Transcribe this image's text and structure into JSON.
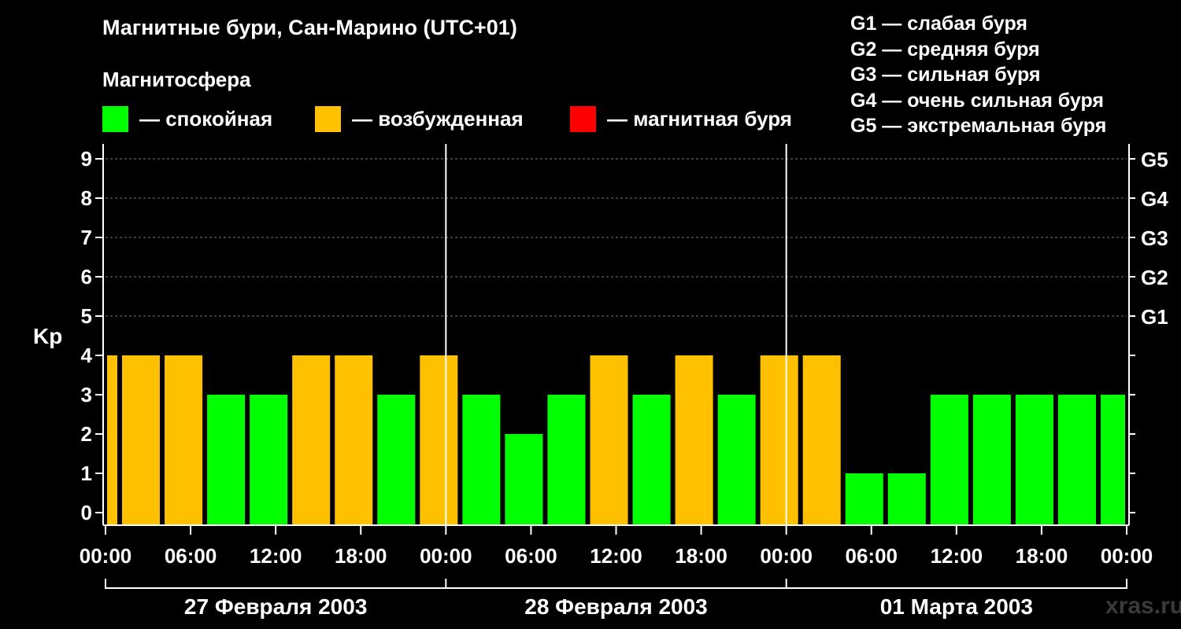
{
  "title": "Магнитные бури, Сан-Марино (UTC+01)",
  "subtitle": "Магнитосфера",
  "legend": [
    {
      "label": "— спокойная",
      "color": "#00ff00"
    },
    {
      "label": "— возбужденная",
      "color": "#ffc000"
    },
    {
      "label": "— магнитная буря",
      "color": "#ff0000"
    }
  ],
  "g_levels": [
    "G1 — слабая буря",
    "G2 — средняя буря",
    "G3 — сильная буря",
    "G4 — очень сильная буря",
    "G5 — экстремальная буря"
  ],
  "watermark": "xras.ru",
  "chart_data": {
    "type": "bar",
    "ylabel": "Kp",
    "ylim": [
      0,
      9
    ],
    "y_ticks": [
      "0",
      "1",
      "2",
      "3",
      "4",
      "5",
      "6",
      "7",
      "8",
      "9"
    ],
    "right_axis_labels": [
      {
        "kp": 5,
        "label": "G1"
      },
      {
        "kp": 6,
        "label": "G2"
      },
      {
        "kp": 7,
        "label": "G3"
      },
      {
        "kp": 8,
        "label": "G4"
      },
      {
        "kp": 9,
        "label": "G5"
      }
    ],
    "x_tick_labels": [
      "00:00",
      "06:00",
      "12:00",
      "18:00",
      "00:00",
      "06:00",
      "12:00",
      "18:00",
      "00:00",
      "06:00",
      "12:00",
      "18:00",
      "00:00"
    ],
    "x_hours_range": [
      0,
      72
    ],
    "day_labels": [
      "27 Февраля 2003",
      "28 Февраля 2003",
      "01 Марта 2003"
    ],
    "grid": "horizontal dashed",
    "colors": {
      "quiet": "#00ff00",
      "active": "#ffc000",
      "storm": "#ff0000"
    },
    "bars": [
      {
        "start_hour": 0,
        "end_hour": 1,
        "kp": 4
      },
      {
        "start_hour": 1,
        "end_hour": 4,
        "kp": 4
      },
      {
        "start_hour": 4,
        "end_hour": 7,
        "kp": 4
      },
      {
        "start_hour": 7,
        "end_hour": 10,
        "kp": 3
      },
      {
        "start_hour": 10,
        "end_hour": 13,
        "kp": 3
      },
      {
        "start_hour": 13,
        "end_hour": 16,
        "kp": 4
      },
      {
        "start_hour": 16,
        "end_hour": 19,
        "kp": 4
      },
      {
        "start_hour": 19,
        "end_hour": 22,
        "kp": 3
      },
      {
        "start_hour": 22,
        "end_hour": 25,
        "kp": 4
      },
      {
        "start_hour": 25,
        "end_hour": 28,
        "kp": 3
      },
      {
        "start_hour": 28,
        "end_hour": 31,
        "kp": 2
      },
      {
        "start_hour": 31,
        "end_hour": 34,
        "kp": 3
      },
      {
        "start_hour": 34,
        "end_hour": 37,
        "kp": 4
      },
      {
        "start_hour": 37,
        "end_hour": 40,
        "kp": 3
      },
      {
        "start_hour": 40,
        "end_hour": 43,
        "kp": 4
      },
      {
        "start_hour": 43,
        "end_hour": 46,
        "kp": 3
      },
      {
        "start_hour": 46,
        "end_hour": 49,
        "kp": 4
      },
      {
        "start_hour": 49,
        "end_hour": 52,
        "kp": 4
      },
      {
        "start_hour": 52,
        "end_hour": 55,
        "kp": 1
      },
      {
        "start_hour": 55,
        "end_hour": 58,
        "kp": 1
      },
      {
        "start_hour": 58,
        "end_hour": 61,
        "kp": 3
      },
      {
        "start_hour": 61,
        "end_hour": 64,
        "kp": 3
      },
      {
        "start_hour": 64,
        "end_hour": 67,
        "kp": 3
      },
      {
        "start_hour": 67,
        "end_hour": 70,
        "kp": 3
      },
      {
        "start_hour": 70,
        "end_hour": 72,
        "kp": 3
      }
    ]
  }
}
